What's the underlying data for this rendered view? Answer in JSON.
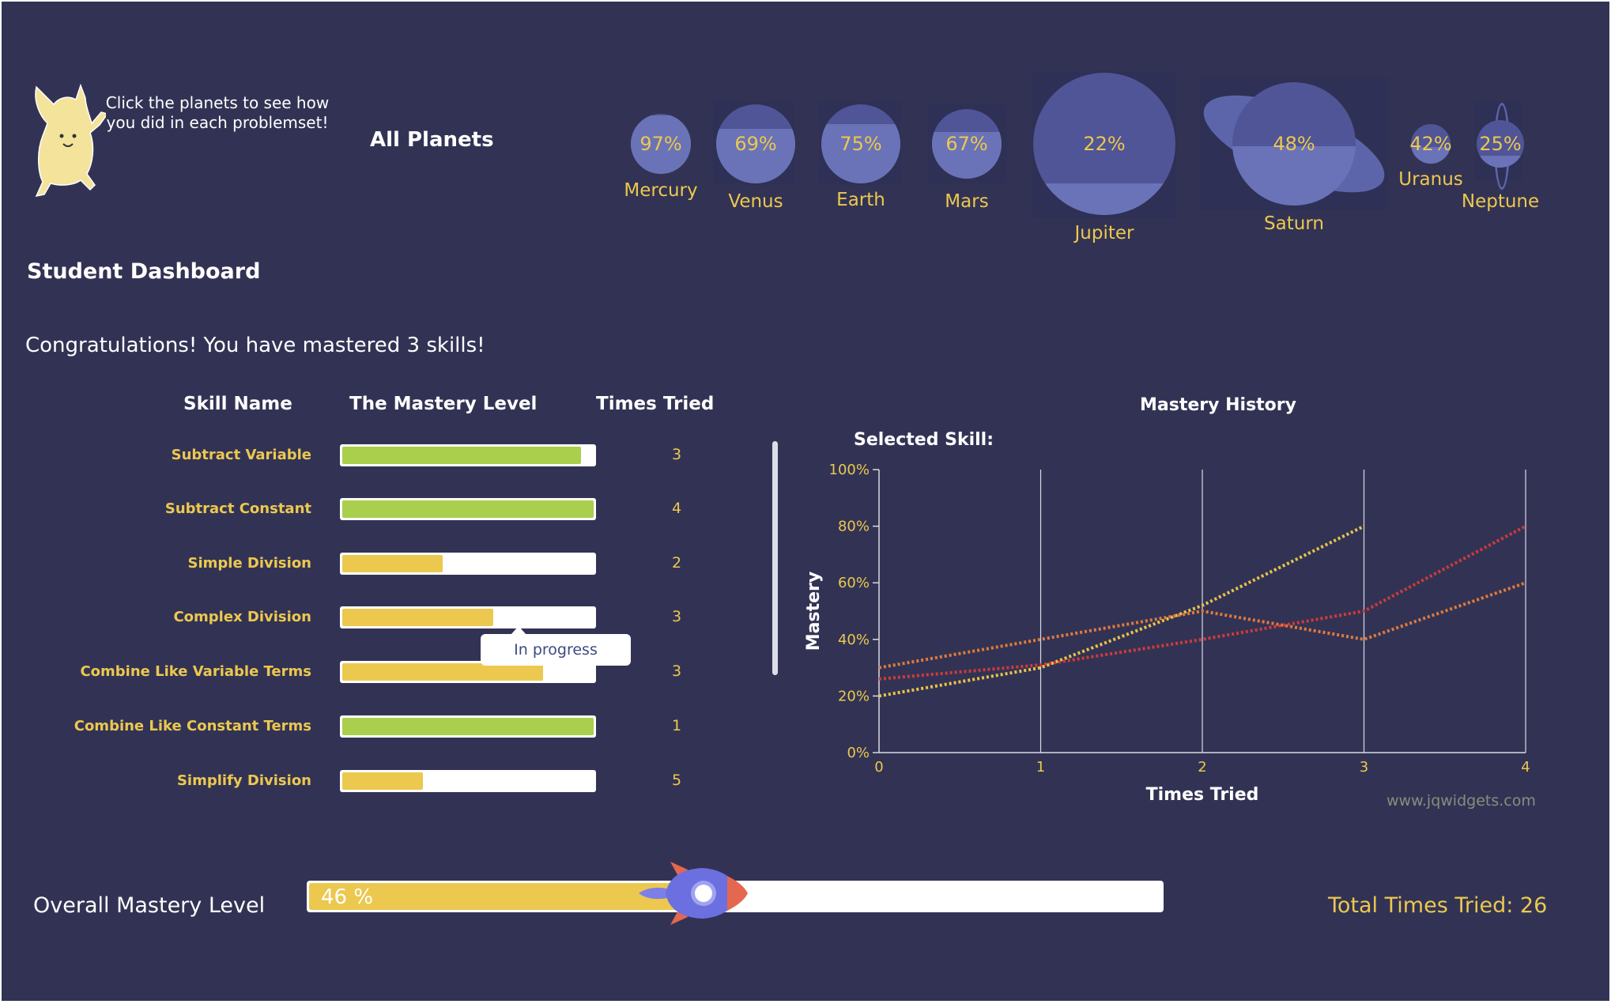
{
  "header": {
    "hint": "Click the planets to see how you did in each problemset!",
    "all_planets": "All Planets",
    "title": "Student Dashboard"
  },
  "planets": [
    {
      "name": "Mercury",
      "percent": "97%",
      "mastery": 0.97
    },
    {
      "name": "Venus",
      "percent": "69%",
      "mastery": 0.69
    },
    {
      "name": "Earth",
      "percent": "75%",
      "mastery": 0.75
    },
    {
      "name": "Mars",
      "percent": "67%",
      "mastery": 0.67
    },
    {
      "name": "Jupiter",
      "percent": "22%",
      "mastery": 0.22
    },
    {
      "name": "Saturn",
      "percent": "48%",
      "mastery": 0.48
    },
    {
      "name": "Uranus",
      "percent": "42%",
      "mastery": 0.42
    },
    {
      "name": "Neptune",
      "percent": "25%",
      "mastery": 0.25
    }
  ],
  "congrats": "Congratulations! You have mastered 3 skills!",
  "table": {
    "headers": {
      "skill": "Skill Name",
      "mastery": "The Mastery Level",
      "tries": "Times Tried"
    },
    "rows": [
      {
        "skill": "Subtract Variable",
        "mastery": 0.95,
        "status": "mastered",
        "tries": "3"
      },
      {
        "skill": "Subtract Constant",
        "mastery": 1.0,
        "status": "mastered",
        "tries": "4"
      },
      {
        "skill": "Simple Division",
        "mastery": 0.4,
        "status": "in-progress",
        "tries": "2"
      },
      {
        "skill": "Complex Division",
        "mastery": 0.6,
        "status": "in-progress",
        "tries": "3"
      },
      {
        "skill": "Combine Like Variable Terms",
        "mastery": 0.8,
        "status": "in-progress",
        "tries": "3"
      },
      {
        "skill": "Combine Like Constant Terms",
        "mastery": 1.0,
        "status": "mastered",
        "tries": "1"
      },
      {
        "skill": "Simplify Division",
        "mastery": 0.32,
        "status": "in-progress",
        "tries": "5"
      }
    ],
    "tooltip": "In progress"
  },
  "colors": {
    "background": "#323354",
    "accent": "#ecc84f",
    "mastered": "#a9cf4c",
    "in_progress": "#ecc84f",
    "planet": "#4f5596"
  },
  "chart_data": {
    "type": "line",
    "title": "Mastery History",
    "subtitle": "Selected Skill:",
    "xlabel": "Times Tried",
    "ylabel": "Mastery",
    "xlim": [
      0,
      4
    ],
    "ylim": [
      0,
      100
    ],
    "x_ticks": [
      "0",
      "1",
      "2",
      "3",
      "4"
    ],
    "y_ticks": [
      "0%",
      "20%",
      "40%",
      "60%",
      "80%",
      "100%"
    ],
    "grid": "vertical",
    "series": [
      {
        "color": "#e8c349",
        "x": [
          0,
          1,
          2,
          3
        ],
        "y": [
          20,
          30,
          52,
          80
        ]
      },
      {
        "color": "#e07a3a",
        "x": [
          0,
          1,
          2,
          3,
          4
        ],
        "y": [
          30,
          40,
          50,
          40,
          60
        ]
      },
      {
        "color": "#cf3b3b",
        "x": [
          0,
          1,
          2,
          3,
          4
        ],
        "y": [
          26,
          31,
          40,
          50,
          80
        ]
      }
    ],
    "watermark": "www.jqwidgets.com"
  },
  "overall": {
    "label": "Overall Mastery Level",
    "percent_text": "46 %",
    "mastery": 0.46,
    "total_tries": "Total Times Tried: 26"
  }
}
